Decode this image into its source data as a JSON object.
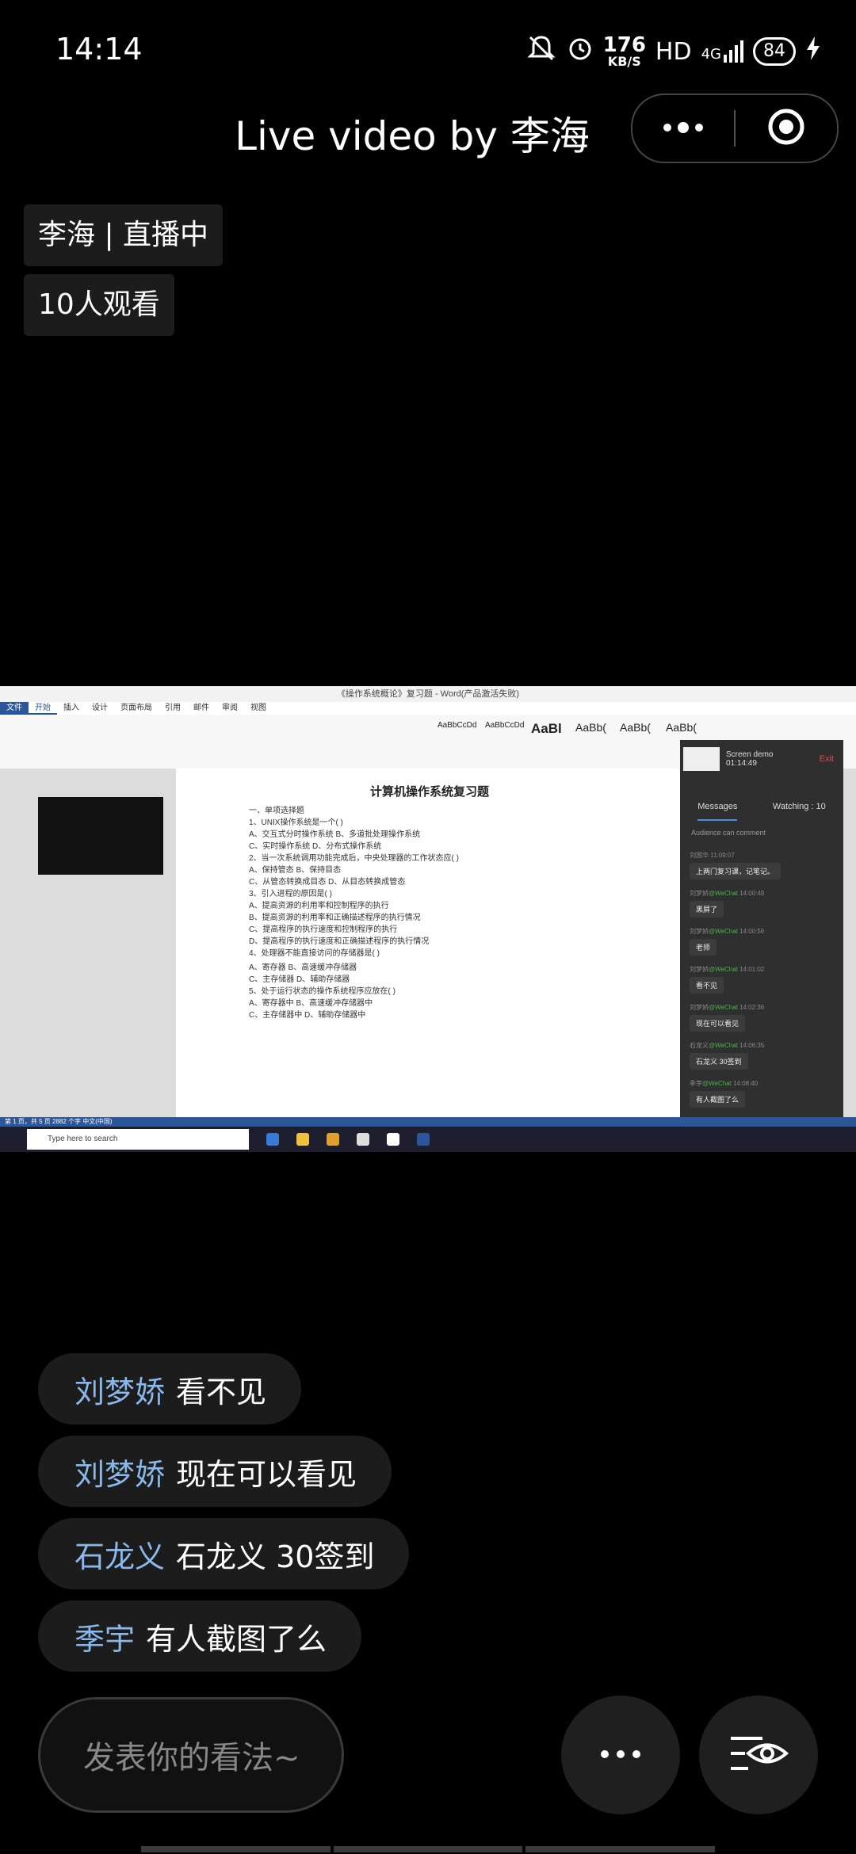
{
  "status_bar": {
    "time": "14:14",
    "net_speed": "176",
    "net_unit": "KB/S",
    "hd": "HD",
    "signal": "4G",
    "battery": "84"
  },
  "header": {
    "title": "Live video by 李海"
  },
  "host": {
    "label": "李海 | 直播中",
    "viewers": "10人观看"
  },
  "stream": {
    "window_title": "《操作系统概论》复习题 - Word(产品激活失败)",
    "tabs": [
      "文件",
      "开始",
      "插入",
      "设计",
      "页面布局",
      "引用",
      "邮件",
      "审阅",
      "视图"
    ],
    "styles": [
      "AaBbCcDd",
      "AaBbCcDd",
      "AaBl",
      "AaBb(",
      "AaBb(",
      "AaBb("
    ],
    "doc_title": "计算机操作系统复习题",
    "doc_lines": [
      "一、单项选择题",
      "1、UNIX操作系统是一个(        )",
      "A、交互式分时操作系统                              B、多道批处理操作系统",
      "C、实时操作系统                                       D、分布式操作系统",
      "2、当一次系统调用功能完成后，中央处理器的工作状态应(        )",
      "A、保持管态                                             B、保持目态",
      "C、从管态转换成目态                                 D、从目态转换成管态",
      "3、引入进程的原因是(        )",
      "A、提高资源的利用率和控制程序的执行",
      "B、提高资源的利用率和正确描述程序的执行情况",
      "C、提高程序的执行速度和控制程序的执行",
      "D、提高程序的执行速度和正确描述程序的执行情况",
      "4、处理器不能直接访问的存储器是(        )",
      "A、寄存器                                                B、高速缓冲存储器",
      "C、主存储器                                             D、辅助存储器",
      "5、处于运行状态的操作系统程序应放在(        )",
      "A、寄存器中                                             B、高速缓冲存储器中",
      "C、主存储器中                                          D、辅助存储器中"
    ],
    "status_text": "第 1 页，共 5 页     2882 个字     中文(中国)",
    "taskbar_search": "Type here to search",
    "panel": {
      "screen_label": "Screen demo",
      "duration": "01:14:49",
      "exit": "Exit",
      "tab_messages": "Messages",
      "tab_watching": "Watching : 10",
      "note": "Audience can comment",
      "messages": [
        {
          "user": "刘国华",
          "wechat": "",
          "time": "11:09:07",
          "text": "上两门复习课，记笔记。"
        },
        {
          "user": "刘梦娇",
          "wechat": "@WeChat",
          "time": "14:00:49",
          "text": "黑屏了"
        },
        {
          "user": "刘梦娇",
          "wechat": "@WeChat",
          "time": "14:00:56",
          "text": "老师"
        },
        {
          "user": "刘梦娇",
          "wechat": "@WeChat",
          "time": "14:01:02",
          "text": "看不见"
        },
        {
          "user": "刘梦娇",
          "wechat": "@WeChat",
          "time": "14:02:36",
          "text": "现在可以看见"
        },
        {
          "user": "石龙义",
          "wechat": "@WeChat",
          "time": "14:06:35",
          "text": "石龙义 30签到"
        },
        {
          "user": "季宇",
          "wechat": "@WeChat",
          "time": "14:08:40",
          "text": "有人截图了么"
        }
      ]
    }
  },
  "comments": [
    {
      "name": "刘梦娇",
      "text": "看不见"
    },
    {
      "name": "刘梦娇",
      "text": "现在可以看见"
    },
    {
      "name": "石龙义",
      "text": "石龙义 30签到"
    },
    {
      "name": "季宇",
      "text": "有人截图了么"
    }
  ],
  "input": {
    "placeholder": "发表你的看法~"
  },
  "icons": {
    "more": "more-dots-icon",
    "viewers": "viewers-eye-icon",
    "record": "record-icon",
    "mute": "bell-off-icon",
    "alarm": "alarm-icon"
  }
}
